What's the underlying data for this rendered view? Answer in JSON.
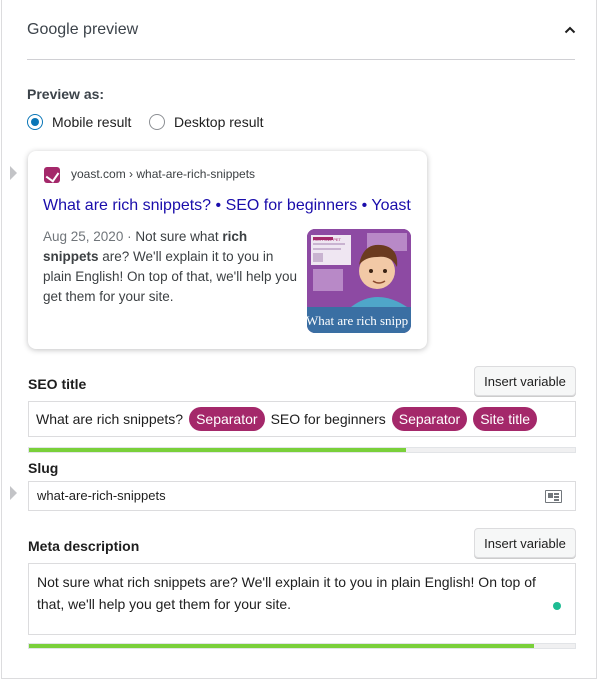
{
  "header": {
    "title": "Google preview"
  },
  "preview": {
    "label": "Preview as:",
    "options": [
      {
        "label": "Mobile result",
        "checked": true
      },
      {
        "label": "Desktop result",
        "checked": false
      }
    ]
  },
  "google_card": {
    "breadcrumb": "yoast.com › what-are-rich-snippets",
    "title": "What are rich snippets? • SEO for beginners • Yoast",
    "date": "Aug 25, 2020",
    "separator": "·",
    "desc_before": "Not sure what ",
    "desc_bold": "rich snippets",
    "desc_after": " are? We'll explain it to you in plain English! On top of that, we'll help you get them for your site.",
    "thumbnail_caption": "What are rich snipp",
    "thumbnail_label_text": "RICH SNIPPET",
    "brand_color": "#a4286a"
  },
  "seo_title": {
    "label": "SEO title",
    "insert_button": "Insert variable",
    "parts": [
      {
        "type": "text",
        "value": "What are rich snippets?"
      },
      {
        "type": "pill",
        "value": "Separator"
      },
      {
        "type": "text",
        "value": "SEO for beginners"
      },
      {
        "type": "pill",
        "value": "Separator"
      },
      {
        "type": "pill",
        "value": "Site title"
      }
    ],
    "progress": 0.69,
    "progress_color": "#7ad03a"
  },
  "slug": {
    "label": "Slug",
    "value": "what-are-rich-snippets",
    "icon": "id-card-icon"
  },
  "meta_description": {
    "label": "Meta description",
    "insert_button": "Insert variable",
    "value": "Not sure what rich snippets are? We'll explain it to you in plain English! On top of that, we'll help you get them for your site.",
    "progress": 0.925,
    "progress_color": "#7ad03a",
    "indicator_color": "#1ebc93"
  }
}
